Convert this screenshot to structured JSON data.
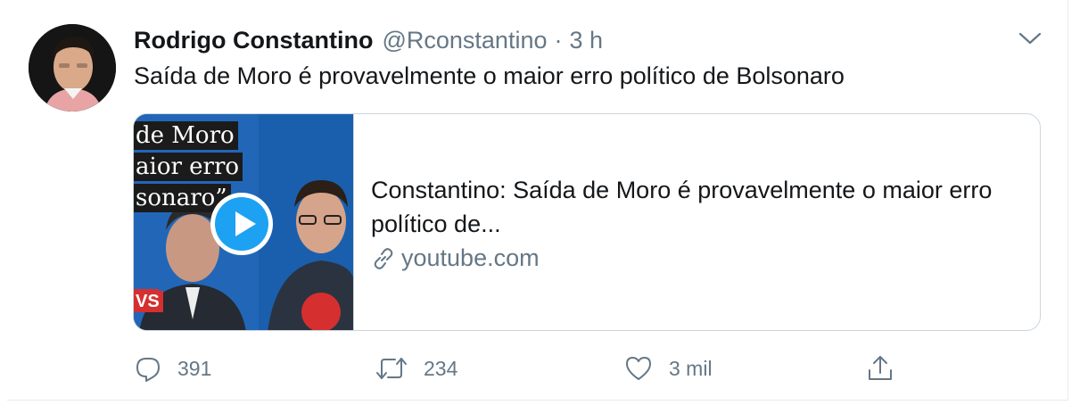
{
  "tweet": {
    "author_name": "Rodrigo Constantino",
    "handle": "@Rconstantino",
    "separator": "·",
    "time": "3 h",
    "text": "Saída de Moro é provavelmente o maior erro político de Bolsonaro"
  },
  "card": {
    "thumbnail_lines": [
      "de Moro",
      "aior erro",
      "sonaro”",
      "VS"
    ],
    "title": "Constantino: Saída de Moro é provavelmente o maior erro político de...",
    "domain": "youtube.com"
  },
  "actions": {
    "reply_count": "391",
    "retweet_count": "234",
    "like_count": "3 mil"
  },
  "icons": {
    "reply": "reply-icon",
    "retweet": "retweet-icon",
    "like": "heart-icon",
    "share": "share-icon",
    "more": "chevron-down-icon",
    "play": "play-icon",
    "link": "link-icon"
  },
  "colors": {
    "text": "#14171a",
    "secondary": "#657786",
    "border": "#ccd6dd",
    "play_blue": "#1da1f2"
  }
}
